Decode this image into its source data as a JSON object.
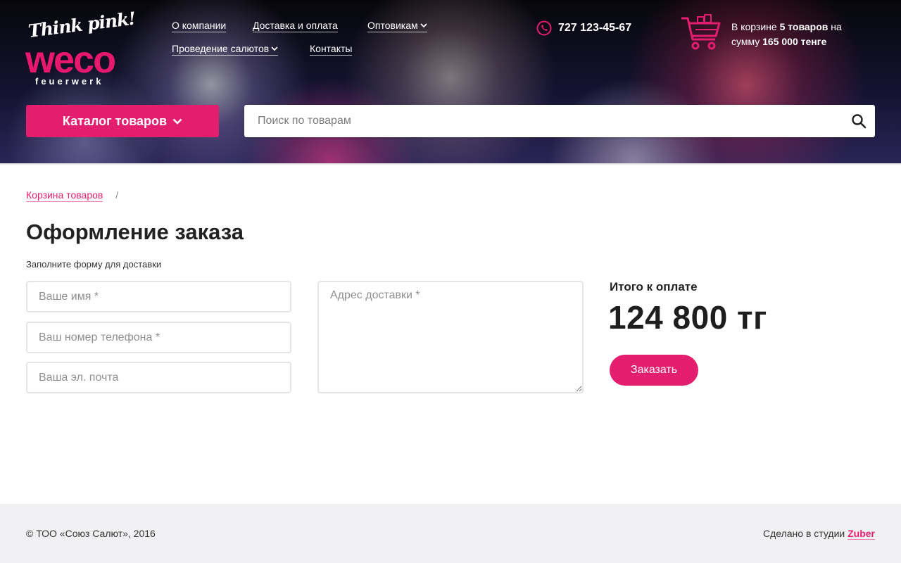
{
  "colors": {
    "accent": "#e41e6f",
    "header_dark": "#07070b",
    "footer_bg": "#f1f1f3",
    "field_border": "#e6e6e6"
  },
  "logo": {
    "tagline": "Think pink!",
    "brand": "weco",
    "sub": "feuerwerk"
  },
  "nav": {
    "items": [
      {
        "label": "О компании",
        "has_dropdown": false
      },
      {
        "label": "Доставка и оплата",
        "has_dropdown": false
      },
      {
        "label": "Оптовикам",
        "has_dropdown": true
      },
      {
        "label": "Проведение салютов",
        "has_dropdown": true
      },
      {
        "label": "Контакты",
        "has_dropdown": false
      }
    ]
  },
  "phone": {
    "icon": "phone-icon",
    "number": "727 123-45-67"
  },
  "cart": {
    "icon": "cart-icon",
    "prefix": "В корзине",
    "count": "5 товаров",
    "middle": "на сумму",
    "sum": "165 000 тенге"
  },
  "catalog": {
    "label": "Каталог товаров"
  },
  "search": {
    "placeholder": "Поиск по товарам",
    "value": ""
  },
  "breadcrumb": {
    "items": [
      {
        "label": "Корзина товаров"
      }
    ],
    "separator": "/"
  },
  "page": {
    "title": "Оформление заказа",
    "hint": "Заполните форму для доставки"
  },
  "form": {
    "name_placeholder": "Ваше имя *",
    "phone_placeholder": "Ваш номер телефона *",
    "email_placeholder": "Ваша эл. почта",
    "address_placeholder": "Адрес доставки *"
  },
  "summary": {
    "label": "Итого к оплате",
    "amount": "124 800 тг",
    "button": "Заказать"
  },
  "footer": {
    "copyright": "© ТОО «Союз Салют», 2016",
    "credit_prefix": "Сделано в студии",
    "credit_link": "Zuber"
  }
}
